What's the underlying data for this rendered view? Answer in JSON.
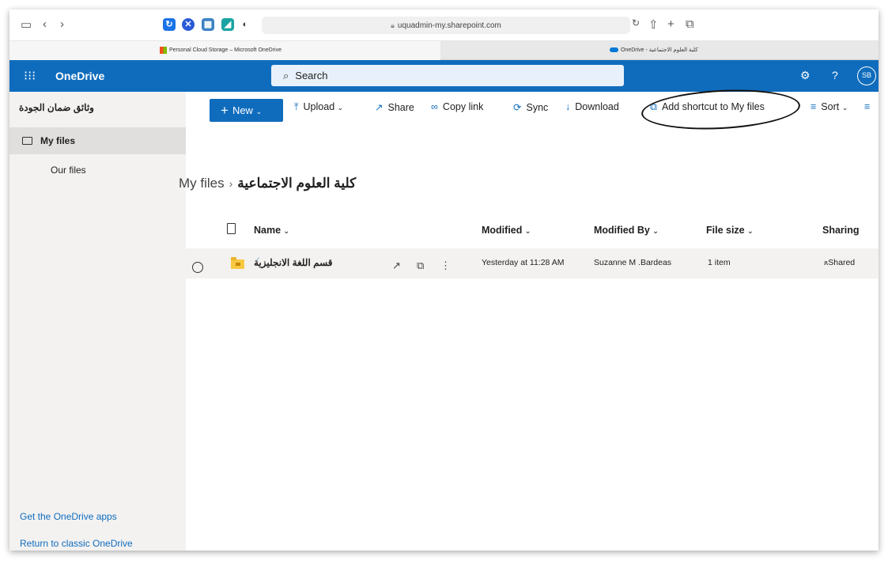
{
  "browser": {
    "url": "uquadmin-my.sharepoint.com",
    "tabs": [
      {
        "title": "Personal Cloud Storage – Microsoft OneDrive"
      },
      {
        "title": "OneDrive - كلية العلوم الاجتماعية"
      }
    ]
  },
  "header": {
    "app_name": "OneDrive",
    "search_placeholder": "Search",
    "avatar_initials": "SB"
  },
  "sidebar": {
    "site_title": "وثائق ضمان الجودة",
    "items": [
      {
        "label": "My files"
      },
      {
        "label": "Our files"
      }
    ],
    "footer_links": [
      {
        "label": "Get the OneDrive apps"
      },
      {
        "label": "Return to classic OneDrive"
      }
    ]
  },
  "commandbar": {
    "new": "New",
    "upload": "Upload",
    "share": "Share",
    "copy_link": "Copy link",
    "sync": "Sync",
    "download": "Download",
    "add_shortcut": "Add shortcut to My files",
    "sort": "Sort"
  },
  "breadcrumb": {
    "parent": "My files",
    "current": "كلية العلوم الاجتماعية"
  },
  "table": {
    "columns": [
      "Name",
      "Modified",
      "Modified By",
      "File size",
      "Sharing"
    ],
    "rows": [
      {
        "name": "قسم اللغة الانجليزية",
        "modified": "Yesterday at 11:28 AM",
        "modified_by": "Suzanne M .Bardeas",
        "file_size": "1 item",
        "sharing": "Shared"
      }
    ]
  },
  "colors": {
    "brand": "#0f6cbd",
    "nav_bg": "#f3f2f1",
    "selected": "#e1dfdd"
  }
}
